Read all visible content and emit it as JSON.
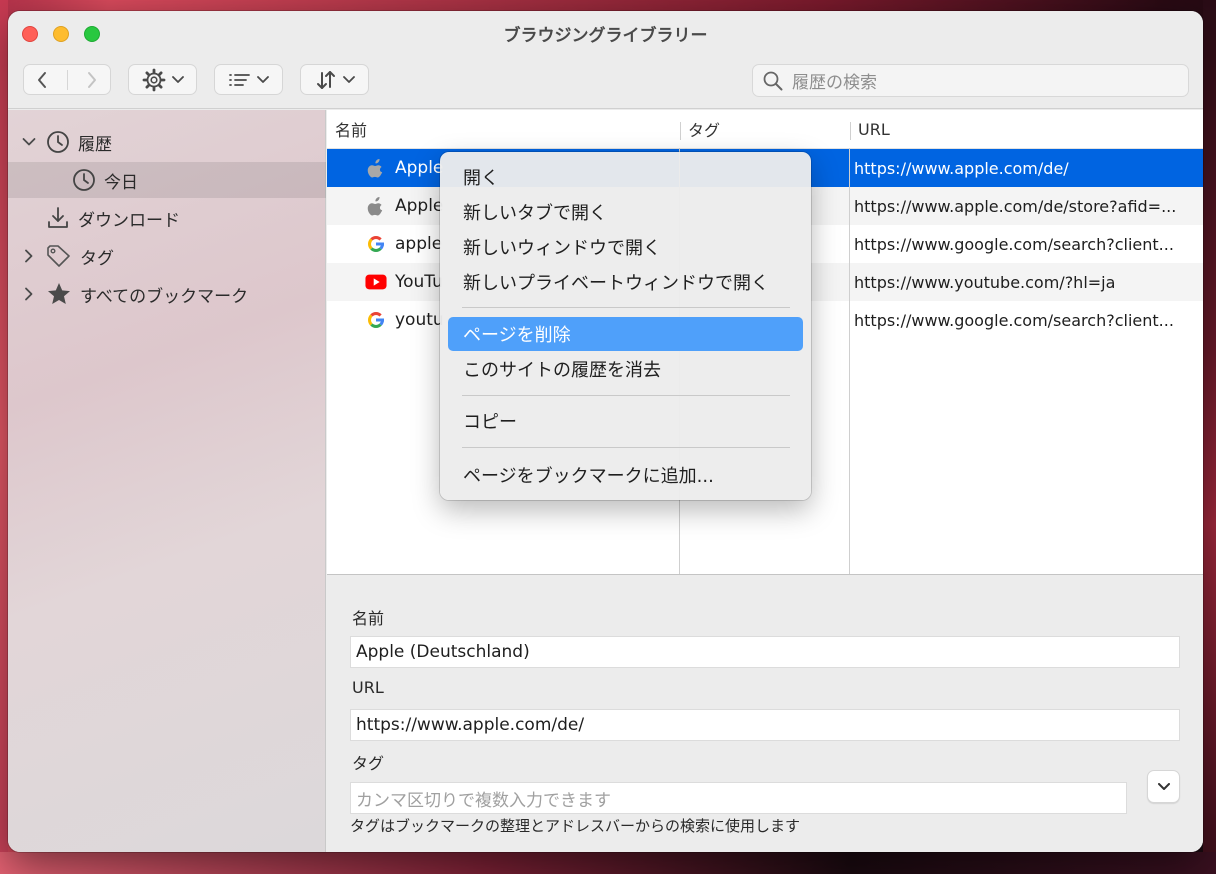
{
  "window": {
    "title": "ブラウジングライブラリー"
  },
  "search": {
    "placeholder": "履歴の検索"
  },
  "sidebar": {
    "items": [
      {
        "label": "履歴",
        "icon": "clock-icon"
      },
      {
        "label": "今日",
        "icon": "clock-icon",
        "selected": true
      },
      {
        "label": "ダウンロード",
        "icon": "download-icon"
      },
      {
        "label": "タグ",
        "icon": "tag-icon"
      },
      {
        "label": "すべてのブックマーク",
        "icon": "star-icon"
      }
    ]
  },
  "table": {
    "columns": [
      "名前",
      "タグ",
      "URL"
    ],
    "rows": [
      {
        "name": "Apple",
        "icon": "apple-icon",
        "url": "https://www.apple.com/de/",
        "selected": true
      },
      {
        "name": "Apple",
        "icon": "apple-icon",
        "url": "https://www.apple.com/de/store?afid=..."
      },
      {
        "name": "apple",
        "icon": "google-icon",
        "url": "https://www.google.com/search?client..."
      },
      {
        "name": "YouTu",
        "icon": "youtube-icon",
        "url": "https://www.youtube.com/?hl=ja"
      },
      {
        "name": "youtu",
        "icon": "google-icon",
        "url": "https://www.google.com/search?client..."
      }
    ]
  },
  "context_menu": {
    "items": [
      "開く",
      "新しいタブで開く",
      "新しいウィンドウで開く",
      "新しいプライベートウィンドウで開く",
      "ページを削除",
      "このサイトの履歴を消去",
      "コピー",
      "ページをブックマークに追加..."
    ],
    "highlighted": "ページを削除"
  },
  "details": {
    "name_label": "名前",
    "name_value": "Apple (Deutschland)",
    "url_label": "URL",
    "url_value": "https://www.apple.com/de/",
    "tag_label": "タグ",
    "tag_placeholder": "カンマ区切りで複数入力できます",
    "hint": "タグはブックマークの整理とアドレスバーからの検索に使用します"
  },
  "colors": {
    "selection": "#0064e1",
    "menu_highlight": "#4fa0fa",
    "close": "#ff5f57",
    "minimize": "#febc2e",
    "zoom": "#28c840"
  }
}
